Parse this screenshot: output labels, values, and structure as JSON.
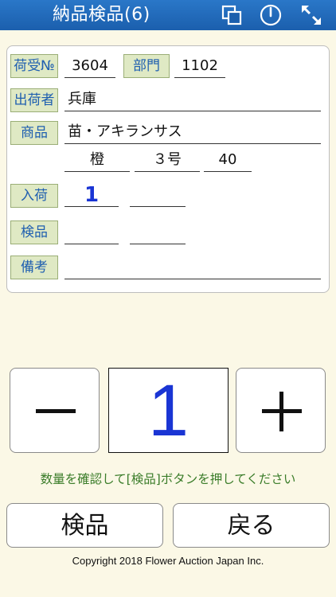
{
  "header": {
    "title": "納品検品(6)",
    "icons": [
      "copy-window-icon",
      "power-icon",
      "expand-icon"
    ]
  },
  "form": {
    "receipt_label": "荷受№",
    "receipt_value": "3604",
    "dept_label": "部門",
    "dept_value": "1102",
    "shipper_label": "出荷者",
    "shipper_value": "兵庫",
    "product_label": "商品",
    "product_value": "苗・アキランサス",
    "color_value": "橙",
    "size_value": "３号",
    "qty_value": "40",
    "arrival_label": "入荷",
    "arrival_value": "1",
    "arrival_value2": "",
    "inspect_label": "検品",
    "inspect_value": "",
    "inspect_value2": "",
    "remarks_label": "備考",
    "remarks_value": ""
  },
  "counter": {
    "minus_label": "−",
    "plus_label": "+",
    "value": "1"
  },
  "message": "数量を確認して[検品]ボタンを押してください",
  "buttons": {
    "inspect": "検品",
    "back": "戻る"
  },
  "copyright": "Copyright 2018 Flower Auction Japan Inc."
}
